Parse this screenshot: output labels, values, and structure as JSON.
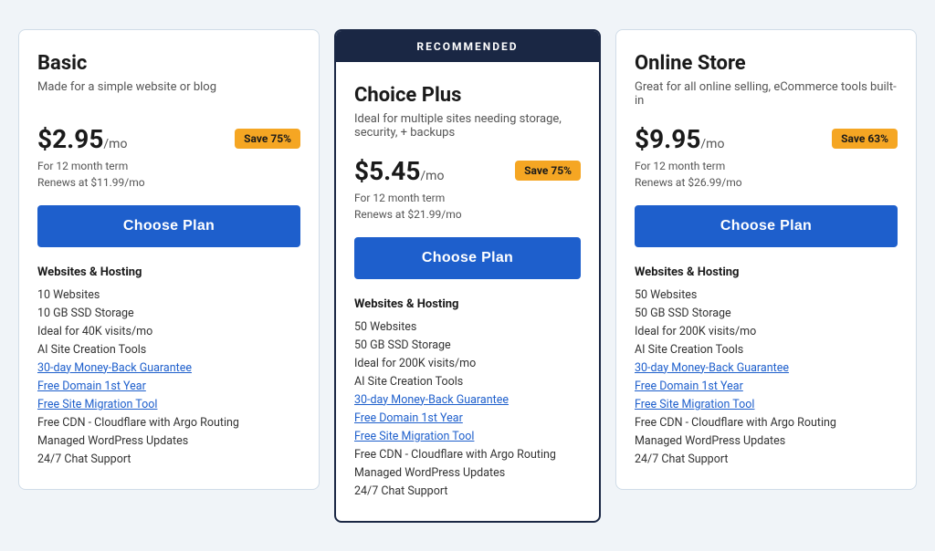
{
  "plans": [
    {
      "id": "basic",
      "name": "Basic",
      "description": "Made for a simple website or blog",
      "price": "$2.95",
      "period": "/mo",
      "save": "Save 75%",
      "billing": "For 12 month term",
      "renewal": "Renews at $11.99/mo",
      "cta": "Choose Plan",
      "recommended": false,
      "features_title": "Websites & Hosting",
      "features": [
        "10 Websites",
        "10 GB SSD Storage",
        "Ideal for 40K visits/mo",
        "AI Site Creation Tools"
      ],
      "feature_links": [
        "30-day Money-Back Guarantee",
        "Free Domain 1st Year",
        "Free Site Migration Tool"
      ],
      "features_after": [
        "Free CDN - Cloudflare with Argo Routing",
        "Managed WordPress Updates",
        "24/7 Chat Support"
      ]
    },
    {
      "id": "choice-plus",
      "name": "Choice Plus",
      "description": "Ideal for multiple sites needing storage, security, + backups",
      "price": "$5.45",
      "period": "/mo",
      "save": "Save 75%",
      "billing": "For 12 month term",
      "renewal": "Renews at $21.99/mo",
      "cta": "Choose Plan",
      "recommended": true,
      "recommended_label": "RECOMMENDED",
      "features_title": "Websites & Hosting",
      "features": [
        "50 Websites",
        "50 GB SSD Storage",
        "Ideal for 200K visits/mo",
        "AI Site Creation Tools"
      ],
      "feature_links": [
        "30-day Money-Back Guarantee",
        "Free Domain 1st Year",
        "Free Site Migration Tool"
      ],
      "features_after": [
        "Free CDN - Cloudflare with Argo Routing",
        "Managed WordPress Updates",
        "24/7 Chat Support"
      ]
    },
    {
      "id": "online-store",
      "name": "Online Store",
      "description": "Great for all online selling, eCommerce tools built-in",
      "price": "$9.95",
      "period": "/mo",
      "save": "Save 63%",
      "billing": "For 12 month term",
      "renewal": "Renews at $26.99/mo",
      "cta": "Choose Plan",
      "recommended": false,
      "features_title": "Websites & Hosting",
      "features": [
        "50 Websites",
        "50 GB SSD Storage",
        "Ideal for 200K visits/mo",
        "AI Site Creation Tools"
      ],
      "feature_links": [
        "30-day Money-Back Guarantee",
        "Free Domain 1st Year",
        "Free Site Migration Tool"
      ],
      "features_after": [
        "Free CDN - Cloudflare with Argo Routing",
        "Managed WordPress Updates",
        "24/7 Chat Support"
      ]
    }
  ]
}
